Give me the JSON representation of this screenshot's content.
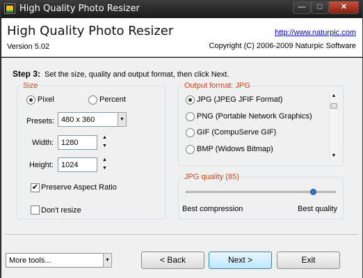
{
  "window": {
    "title": "High Quality Photo Resizer",
    "min_glyph": "—",
    "max_glyph": "□",
    "close_glyph": "✕"
  },
  "header": {
    "app_name": "High Quality Photo Resizer",
    "version": "Version 5.02",
    "link": "http://www.naturpic.com",
    "copyright": "Copyright (C) 2006-2009 Naturpic Software"
  },
  "step": {
    "label": "Step 3:",
    "instruction": "Set the size, quality and output format, then click Next."
  },
  "size": {
    "group_title": "Size",
    "mode_pixel": "Pixel",
    "mode_percent": "Percent",
    "selected_mode": "Pixel",
    "presets_label": "Presets:",
    "presets_value": "480 x 360",
    "width_label": "Width:",
    "width_value": "1280",
    "height_label": "Height:",
    "height_value": "1024",
    "preserve_label": "Preserve Aspect Ratio",
    "preserve_checked": true,
    "dont_resize_label": "Don't resize",
    "dont_resize_checked": false
  },
  "format": {
    "group_title": "Output format: JPG",
    "options": [
      {
        "label": "JPG (JPEG JFIF Format)",
        "selected": true
      },
      {
        "label": "PNG (Portable Network Graphics)",
        "selected": false
      },
      {
        "label": "GIF (CompuServe GIF)",
        "selected": false
      },
      {
        "label": "BMP (Widows Bitmap)",
        "selected": false
      }
    ]
  },
  "quality": {
    "group_title": "JPG quality (85)",
    "value": 85,
    "min": 0,
    "max": 100,
    "low_label": "Best compression",
    "high_label": "Best quality"
  },
  "footer": {
    "more_tools": "More tools...",
    "back_label": "< Back",
    "next_label": "Next >",
    "exit_label": "Exit"
  },
  "colors": {
    "accent_title": "#d04020",
    "link": "#0000cc"
  }
}
